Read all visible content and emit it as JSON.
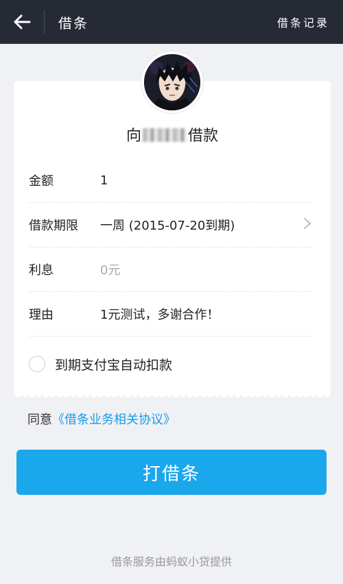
{
  "header": {
    "title": "借条",
    "records_label": "借条记录"
  },
  "card": {
    "borrow_prefix": "向",
    "borrow_suffix": "借款",
    "rows": [
      {
        "label": "金额",
        "value": "1"
      },
      {
        "label": "借款期限",
        "value": "一周 (2015-07-20到期)"
      },
      {
        "label": "利息",
        "value": "0元"
      },
      {
        "label": "理由",
        "value": "1元测试，多谢合作！"
      }
    ],
    "auto_deduct_label": "到期支付宝自动扣款"
  },
  "agreement": {
    "prefix": "同意",
    "link": "《借条业务相关协议》"
  },
  "main_button_label": "打借条",
  "footer_text": "借条服务由蚂蚁小贷提供",
  "colors": {
    "topbar": "#262a35",
    "accent": "#1aa7ec",
    "link": "#1a9be6"
  }
}
